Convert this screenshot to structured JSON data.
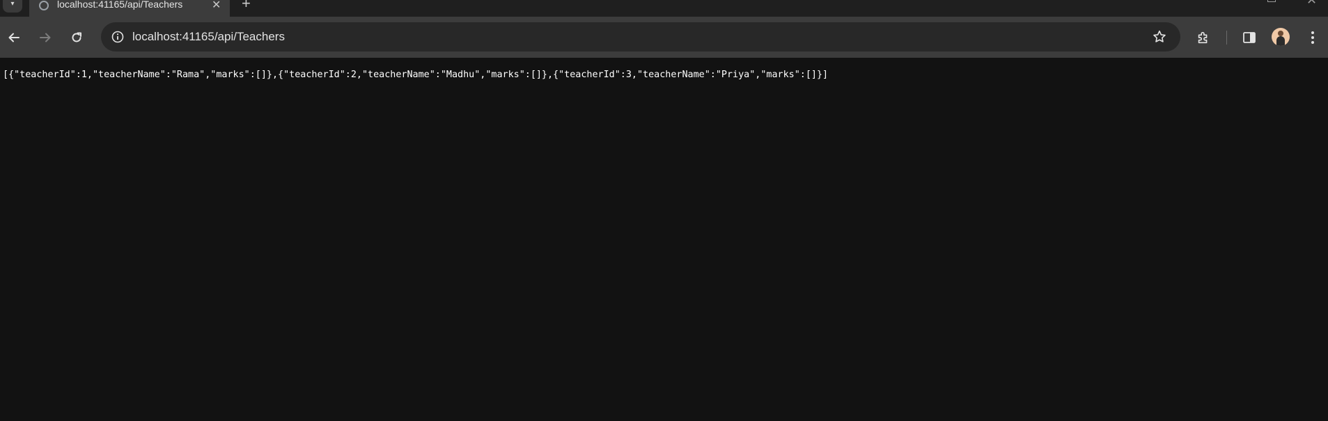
{
  "tab": {
    "title": "localhost:41165/api/Teachers",
    "close_symbol": "✕",
    "new_tab_symbol": "+",
    "favicon": "globe-icon"
  },
  "toolbar": {
    "back_icon": "arrow-left-icon",
    "forward_icon": "arrow-right-icon",
    "reload_icon": "reload-icon",
    "url": "localhost:41165/api/Teachers",
    "site_info_icon": "info-icon",
    "bookmark_icon": "star-icon",
    "extensions_icon": "puzzle-icon",
    "side_panel_icon": "side-panel-icon",
    "menu_icon": "kebab-menu-icon"
  },
  "window": {
    "close_symbol": "✕"
  },
  "page": {
    "json_body": "[{\"teacherId\":1,\"teacherName\":\"Rama\",\"marks\":[]},{\"teacherId\":2,\"teacherName\":\"Madhu\",\"marks\":[]},{\"teacherId\":3,\"teacherName\":\"Priya\",\"marks\":[]}]"
  },
  "colors": {
    "page_background": "#121212",
    "toolbar_background": "#3c3c3c",
    "omnibox_background": "#282828",
    "text": "#e3e3e3"
  }
}
